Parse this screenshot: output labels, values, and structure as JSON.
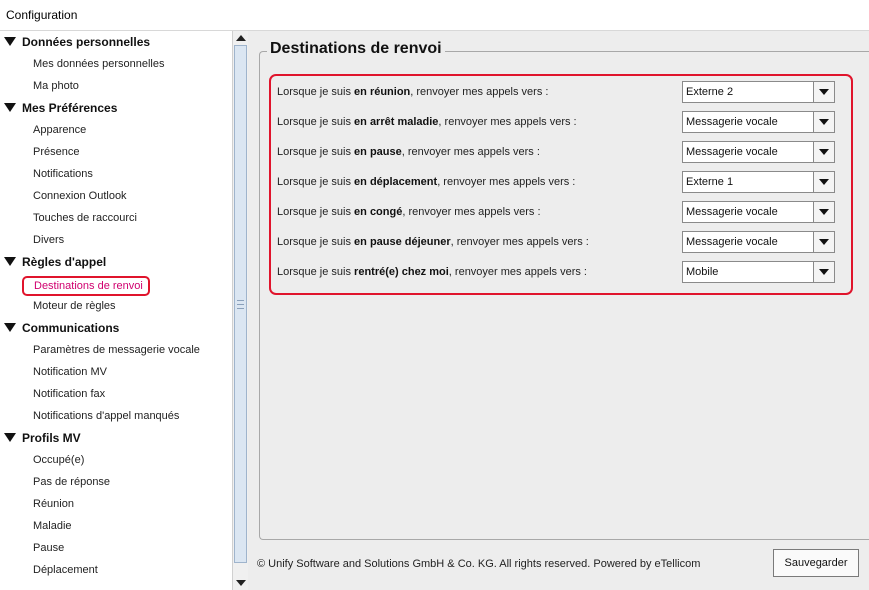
{
  "window": {
    "title": "Configuration"
  },
  "sidebar": {
    "groups": [
      {
        "label": "Données personnelles",
        "items": [
          "Mes données personnelles",
          "Ma photo"
        ]
      },
      {
        "label": "Mes Préférences",
        "items": [
          "Apparence",
          "Présence",
          "Notifications",
          "Connexion Outlook",
          "Touches de raccourci",
          "Divers"
        ]
      },
      {
        "label": "Règles d'appel",
        "items": [
          "Destinations de renvoi",
          "Moteur de règles"
        ]
      },
      {
        "label": "Communications",
        "items": [
          "Paramètres de messagerie vocale",
          "Notification MV",
          "Notification fax",
          "Notifications d'appel manqués"
        ]
      },
      {
        "label": "Profils MV",
        "items": [
          "Occupé(e)",
          "Pas de réponse",
          "Réunion",
          "Maladie",
          "Pause",
          "Déplacement"
        ]
      }
    ],
    "selected": "Destinations de renvoi"
  },
  "panel": {
    "title": "Destinations de renvoi",
    "label_prefix": "Lorsque je suis ",
    "label_suffix": ", renvoyer mes appels vers :",
    "rules": [
      {
        "state": "en réunion",
        "target": "Externe 2"
      },
      {
        "state": "en arrêt maladie",
        "target": "Messagerie vocale"
      },
      {
        "state": "en pause",
        "target": "Messagerie vocale"
      },
      {
        "state": "en déplacement",
        "target": "Externe 1"
      },
      {
        "state": "en congé",
        "target": "Messagerie vocale"
      },
      {
        "state": "en pause déjeuner",
        "target": "Messagerie vocale"
      },
      {
        "state": "rentré(e) chez moi",
        "target": "Mobile"
      }
    ]
  },
  "footer": {
    "copyright": "© Unify Software and Solutions GmbH & Co. KG. All rights reserved. Powered by eTellicom",
    "save_label": "Sauvegarder"
  },
  "colors": {
    "highlight": "#e0142c",
    "selected_text": "#d0006f"
  },
  "icons": {
    "expanded": "triangle-down-icon",
    "dropdown": "chevron-down-icon"
  }
}
